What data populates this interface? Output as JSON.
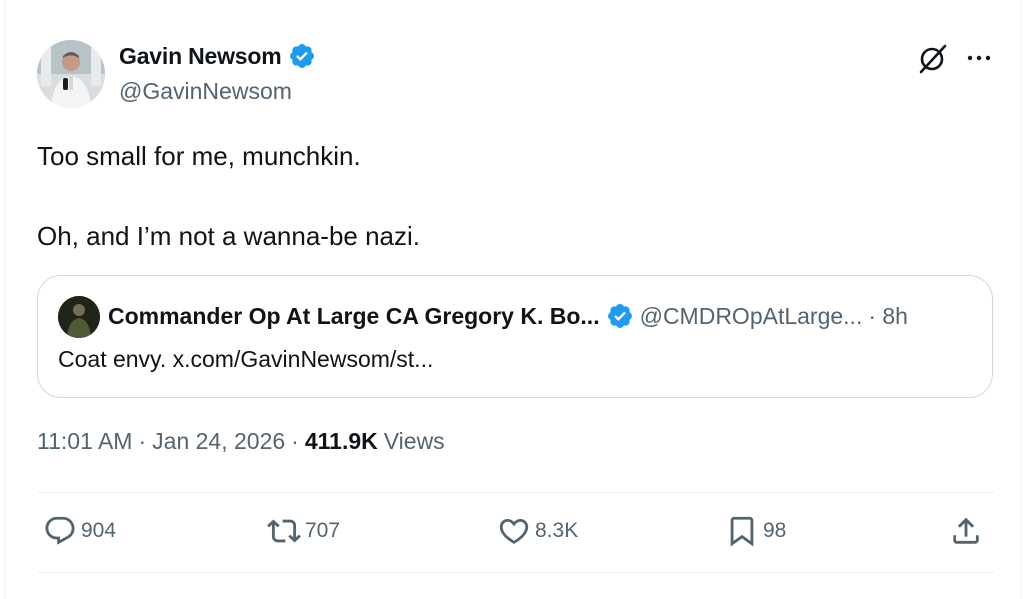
{
  "tweet": {
    "author_name": "Gavin Newsom",
    "author_handle": "@GavinNewsom",
    "paragraphs": [
      "Too small for me, munchkin.",
      "Oh, and I’m not a wanna-be nazi."
    ],
    "time": "11:01 AM",
    "date": "Jan 24, 2026",
    "sep": "·",
    "views_count": "411.9K",
    "views_label": "Views"
  },
  "quote": {
    "author_name": "Commander Op At Large CA Gregory K. Bo...",
    "author_handle": "@CMDROpAtLarge...",
    "age": "· 8h",
    "text": "Coat envy. x.com/GavinNewsom/st..."
  },
  "actions": {
    "replies": "904",
    "reposts": "707",
    "likes": "8.3K",
    "bookmarks": "98"
  },
  "icons": {
    "verified": "verified-badge-icon",
    "grok": "grok-icon",
    "more": "more-icon",
    "reply": "reply-icon",
    "repost": "repost-icon",
    "like": "heart-icon",
    "bookmark": "bookmark-icon",
    "share": "share-icon"
  },
  "colors": {
    "verified": "#1d9bf0",
    "text": "#0f1419",
    "secondary": "#536471",
    "border": "#cfd9de"
  }
}
